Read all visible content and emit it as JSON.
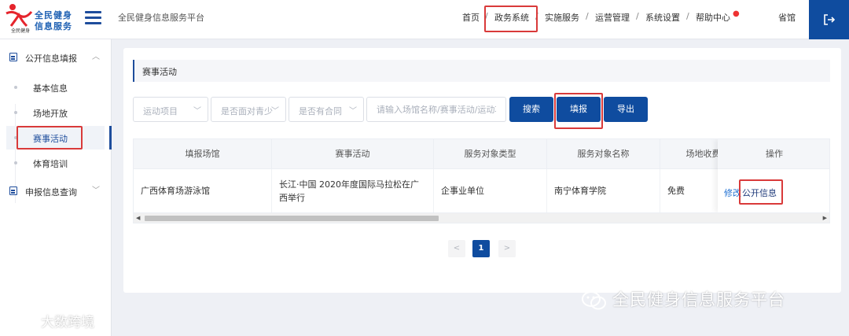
{
  "header": {
    "logo_line1": "全民健身",
    "logo_line2": "信息服务",
    "logo_sub": "全民健身",
    "platform_title": "全民健身信息服务平台",
    "nav": [
      {
        "label": "首页"
      },
      {
        "label": "政务系统"
      },
      {
        "label": "实施服务"
      },
      {
        "label": "运营管理"
      },
      {
        "label": "系统设置"
      },
      {
        "label": "帮助中心"
      }
    ],
    "nav_separator": "/",
    "help_dot": "●",
    "user_name": "省馆"
  },
  "sidebar": {
    "groups": [
      {
        "label": "公开信息填报",
        "arrow": "︿",
        "items": [
          {
            "label": "基本信息"
          },
          {
            "label": "场地开放"
          },
          {
            "label": "赛事活动",
            "active": true
          },
          {
            "label": "体育培训"
          }
        ]
      },
      {
        "label": "申报信息查询",
        "arrow": "﹀"
      }
    ]
  },
  "main": {
    "section_title": "赛事活动",
    "filters": {
      "activity_type": "运动项目",
      "face_to_face": "是否面对青少",
      "has_contract": "是否有合同",
      "search_placeholder": "请输入场馆名称/赛事活动/运动项目",
      "arrow": "﹀"
    },
    "buttons": {
      "search": "搜索",
      "fill": "填报",
      "export": "导出"
    },
    "table": {
      "columns": [
        "填报场馆",
        "赛事活动",
        "服务对象类型",
        "服务对象名称",
        "场地收费",
        "操作"
      ],
      "rows": [
        {
          "venue": "广西体育场游泳馆",
          "event": "长江·中国 2020年度国际马拉松在广西举行",
          "service_type": "企事业单位",
          "service_name": "南宁体育学院",
          "fee": "免费",
          "actions": {
            "edit": "修改",
            "publish": "公开信息"
          }
        }
      ]
    },
    "scroll": {
      "left": "◀",
      "right": "▶"
    },
    "pagination": {
      "prev": "<",
      "current": "1",
      "next": ">"
    }
  },
  "watermarks": {
    "right": "全民健身信息服务平台",
    "left": "大数跨境"
  },
  "colors": {
    "primary": "#0f4c9f",
    "highlight": "#d93a3a",
    "link": "#1f6fd1"
  }
}
